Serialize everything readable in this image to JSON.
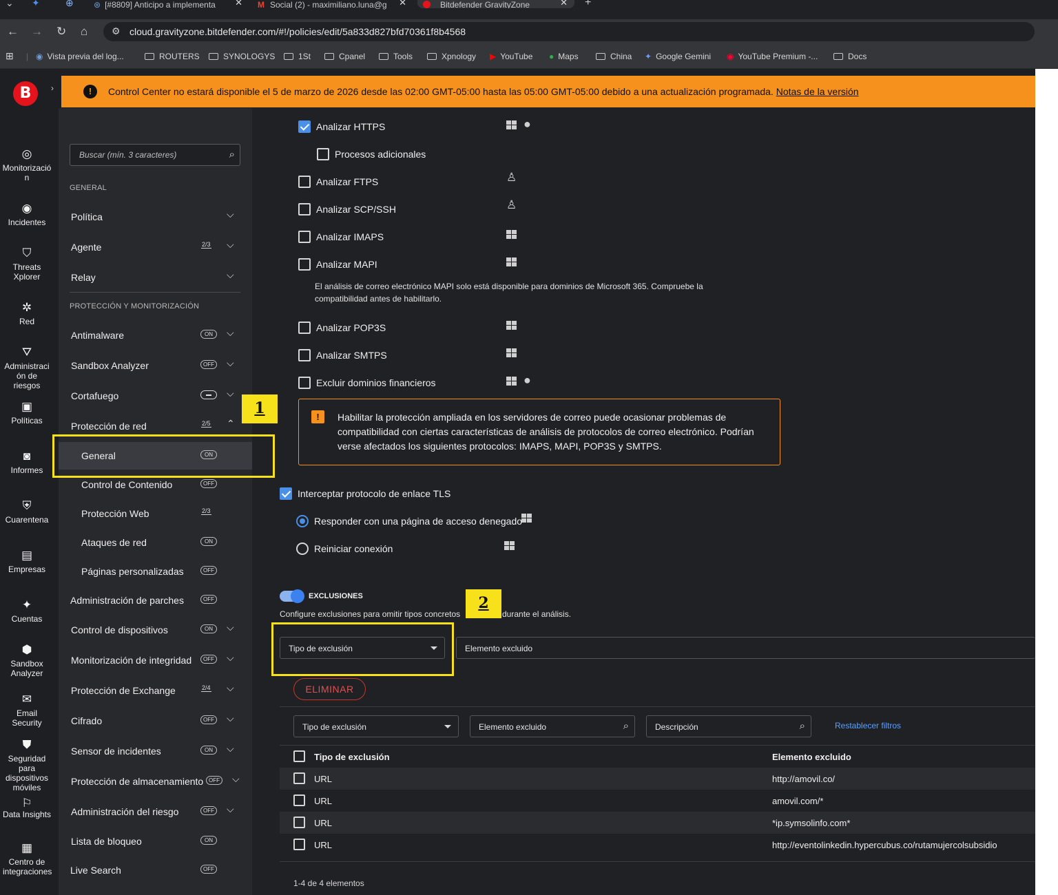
{
  "browser": {
    "tabs": [
      {
        "title": "[#8809] Anticipo a implementa"
      },
      {
        "title": "Social (2) - maximiliano.luna@g"
      },
      {
        "title": "Bitdefender GravityZone"
      }
    ],
    "url": "cloud.gravityzone.bitdefender.com/#!/policies/edit/5a833d827bfd70361f8b4568",
    "bookmarks": [
      {
        "label": "Vista previa del log..."
      },
      {
        "label": "ROUTERS"
      },
      {
        "label": "SYNOLOGYS"
      },
      {
        "label": "1St"
      },
      {
        "label": "Cpanel"
      },
      {
        "label": "Tools"
      },
      {
        "label": "Xpnology"
      },
      {
        "label": "YouTube"
      },
      {
        "label": "Maps"
      },
      {
        "label": "China"
      },
      {
        "label": "Google Gemini"
      },
      {
        "label": "YouTube Premium -..."
      },
      {
        "label": "Docs"
      }
    ]
  },
  "banner": {
    "message": "Control Center no estará disponible el 5 de marzo de 2026 desde las 02:00 GMT-05:00 hasta las 05:00 GMT-05:00 debido a una actualización programada. ",
    "link": "Notas de la versión",
    "color": "#f7911d"
  },
  "rail": {
    "logo": "B",
    "items": [
      {
        "label": "Monitorizació n",
        "icon": "radar-icon"
      },
      {
        "label": "Incidentes",
        "icon": "target-icon"
      },
      {
        "label": "Threats Xplorer",
        "icon": "shield-icon"
      },
      {
        "label": "Red",
        "icon": "network-icon"
      },
      {
        "label": "Administraci ón de riesgos",
        "icon": "risk-icon"
      },
      {
        "label": "Políticas",
        "icon": "policy-icon"
      },
      {
        "label": "Informes",
        "icon": "report-icon"
      },
      {
        "label": "Cuarentena",
        "icon": "quarantine-icon"
      },
      {
        "label": "Empresas",
        "icon": "briefcase-icon"
      },
      {
        "label": "Cuentas",
        "icon": "users-icon"
      },
      {
        "label": "Sandbox Analyzer",
        "icon": "cube-icon"
      },
      {
        "label": "Email Security",
        "icon": "mail-icon"
      },
      {
        "label": "Seguridad para dispositivos móviles",
        "icon": "mobile-shield-icon"
      },
      {
        "label": "Data Insights",
        "icon": "insights-icon"
      },
      {
        "label": "Centro de integraciones",
        "icon": "integrations-icon"
      }
    ]
  },
  "sidebar": {
    "search_placeholder": "Buscar (mín. 3 caracteres)",
    "section_general": "GENERAL",
    "section_protection": "PROTECCIÓN Y MONITORIZACIÓN",
    "general_items": [
      {
        "label": "Política",
        "status": ""
      },
      {
        "label": "Agente",
        "status": "2/3"
      },
      {
        "label": "Relay",
        "status": ""
      }
    ],
    "protection_items": [
      {
        "label": "Antimalware",
        "status": "ON"
      },
      {
        "label": "Sandbox Analyzer",
        "status": "OFF"
      },
      {
        "label": "Cortafuego",
        "status": "minus"
      },
      {
        "label": "Protección de red",
        "status": "2/5"
      }
    ],
    "sub_items": [
      {
        "label": "General",
        "status": "ON"
      },
      {
        "label": "Control de Contenido",
        "status": "OFF"
      },
      {
        "label": "Protección Web",
        "status": "2/3"
      },
      {
        "label": "Ataques de red",
        "status": "ON"
      },
      {
        "label": "Páginas personalizadas",
        "status": "OFF"
      }
    ],
    "more_items": [
      {
        "label": "Administración de parches",
        "status": "OFF"
      },
      {
        "label": "Control de dispositivos",
        "status": "ON"
      },
      {
        "label": "Monitorización de integridad",
        "status": "OFF"
      },
      {
        "label": "Protección de Exchange",
        "status": "2/4"
      },
      {
        "label": "Cifrado",
        "status": "OFF"
      },
      {
        "label": "Sensor de incidentes",
        "status": "ON"
      },
      {
        "label": "Protección de almacenamiento",
        "status": "OFF"
      },
      {
        "label": "Administración del riesgo",
        "status": "OFF"
      },
      {
        "label": "Lista de bloqueo",
        "status": "ON"
      },
      {
        "label": "Live Search",
        "status": "OFF"
      }
    ]
  },
  "main": {
    "options": [
      {
        "label": "Analizar HTTPS",
        "checked": true,
        "os": "windows-apple"
      },
      {
        "label": "Procesos adicionales",
        "checked": false,
        "os": ""
      },
      {
        "label": "Analizar FTPS",
        "checked": false,
        "os": "linux"
      },
      {
        "label": "Analizar SCP/SSH",
        "checked": false,
        "os": "linux"
      },
      {
        "label": "Analizar IMAPS",
        "checked": false,
        "os": "windows"
      },
      {
        "label": "Analizar MAPI",
        "checked": false,
        "os": "windows"
      },
      {
        "label": "Analizar POP3S",
        "checked": false,
        "os": "windows"
      },
      {
        "label": "Analizar SMTPS",
        "checked": false,
        "os": "windows"
      },
      {
        "label": "Excluir dominios financieros",
        "checked": false,
        "os": "windows-apple"
      }
    ],
    "mapi_note_1": "El análisis de correo electrónico MAPI solo está disponible para dominios de Microsoft 365. Compruebe la",
    "mapi_note_2": "compatibilidad antes de habilitarlo.",
    "alert_text": "Habilitar la protección ampliada en los servidores de correo puede ocasionar problemas de compatibilidad con ciertas características de análisis de protocolos de correo electrónico. Podrían verse afectados los siguientes protocolos: IMAPS, MAPI, POP3S y SMTPS.",
    "alert_icon": "!",
    "tls_label": "Interceptar protocolo de enlace TLS",
    "tls_checked": true,
    "radio_deny": "Responder con una página de acceso denegado",
    "radio_reset": "Reiniciar conexión",
    "exclusions_title": "EXCLUSIONES",
    "exclusions_desc_a": "Configure exclusiones para omitir tipos concretos",
    "exclusions_desc_b": "durante el análisis.",
    "type_select": "Tipo de exclusión",
    "element_field": "Elemento excluido",
    "delete_button": "ELIMINAR",
    "filter_type": "Tipo de exclusión",
    "filter_element": "Elemento excluido",
    "filter_desc": "Descripción",
    "reset_filters": "Restablecer filtros",
    "table": {
      "headers": [
        "Tipo de exclusión",
        "Elemento excluido"
      ],
      "rows": [
        [
          "URL",
          "http://amovil.co/"
        ],
        [
          "URL",
          "amovil.com/*"
        ],
        [
          "URL",
          "*ip.symsolinfo.com*"
        ],
        [
          "URL",
          "http://eventolinkedin.hypercubus.co/rutamujercolsubsidio"
        ]
      ]
    },
    "pager": "1-4 de 4 elementos"
  },
  "annotations": {
    "badge1": "1",
    "badge2": "2",
    "color": "#f6e11a"
  }
}
